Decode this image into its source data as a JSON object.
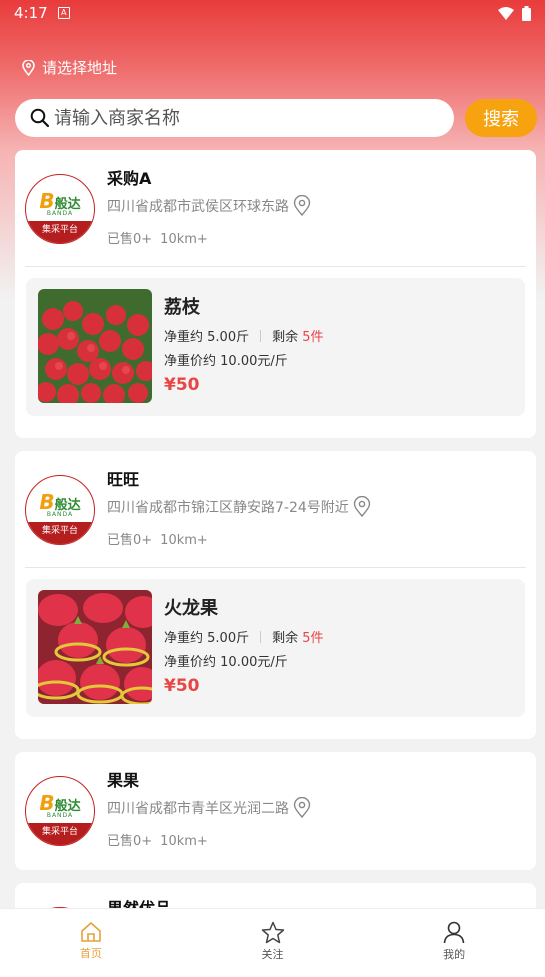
{
  "status_bar": {
    "time": "4:17",
    "app_glyph": "A"
  },
  "location": {
    "label": "请选择地址",
    "icon": "location-pin-icon"
  },
  "search": {
    "placeholder": "请输入商家名称",
    "button_label": "搜索"
  },
  "colors": {
    "accent": "#f7a20f",
    "brand_red": "#b51e1e",
    "price_red": "#e84545",
    "active_tab": "#e6a13a"
  },
  "logo": {
    "letter": "B",
    "name": "般达",
    "latin": "BANDA",
    "slogan": "集采平台"
  },
  "stores": [
    {
      "name": "采购A",
      "address": "四川省成都市武侯区环球东路",
      "sold": "已售0+",
      "distance": "10km+",
      "product": {
        "name": "荔枝",
        "net_weight_label": "净重约",
        "net_weight": "5.00斤",
        "remaining_label": "剩余",
        "remaining": "5件",
        "unit_price_label": "净重价约",
        "unit_price": "10.00元/斤",
        "price": "¥50",
        "image": "lychee"
      }
    },
    {
      "name": "旺旺",
      "address": "四川省成都市锦江区静安路7-24号附近",
      "sold": "已售0+",
      "distance": "10km+",
      "product": {
        "name": "火龙果",
        "net_weight_label": "净重约",
        "net_weight": "5.00斤",
        "remaining_label": "剩余",
        "remaining": "5件",
        "unit_price_label": "净重价约",
        "unit_price": "10.00元/斤",
        "price": "¥50",
        "image": "dragon-fruit"
      }
    },
    {
      "name": "果果",
      "address": "四川省成都市青羊区光润二路",
      "sold": "已售0+",
      "distance": "10km+"
    },
    {
      "name": "果然优品"
    }
  ],
  "tabs": [
    {
      "label": "首页",
      "icon": "home-icon",
      "active": true
    },
    {
      "label": "关注",
      "icon": "star-icon",
      "active": false
    },
    {
      "label": "我的",
      "icon": "user-icon",
      "active": false
    }
  ]
}
